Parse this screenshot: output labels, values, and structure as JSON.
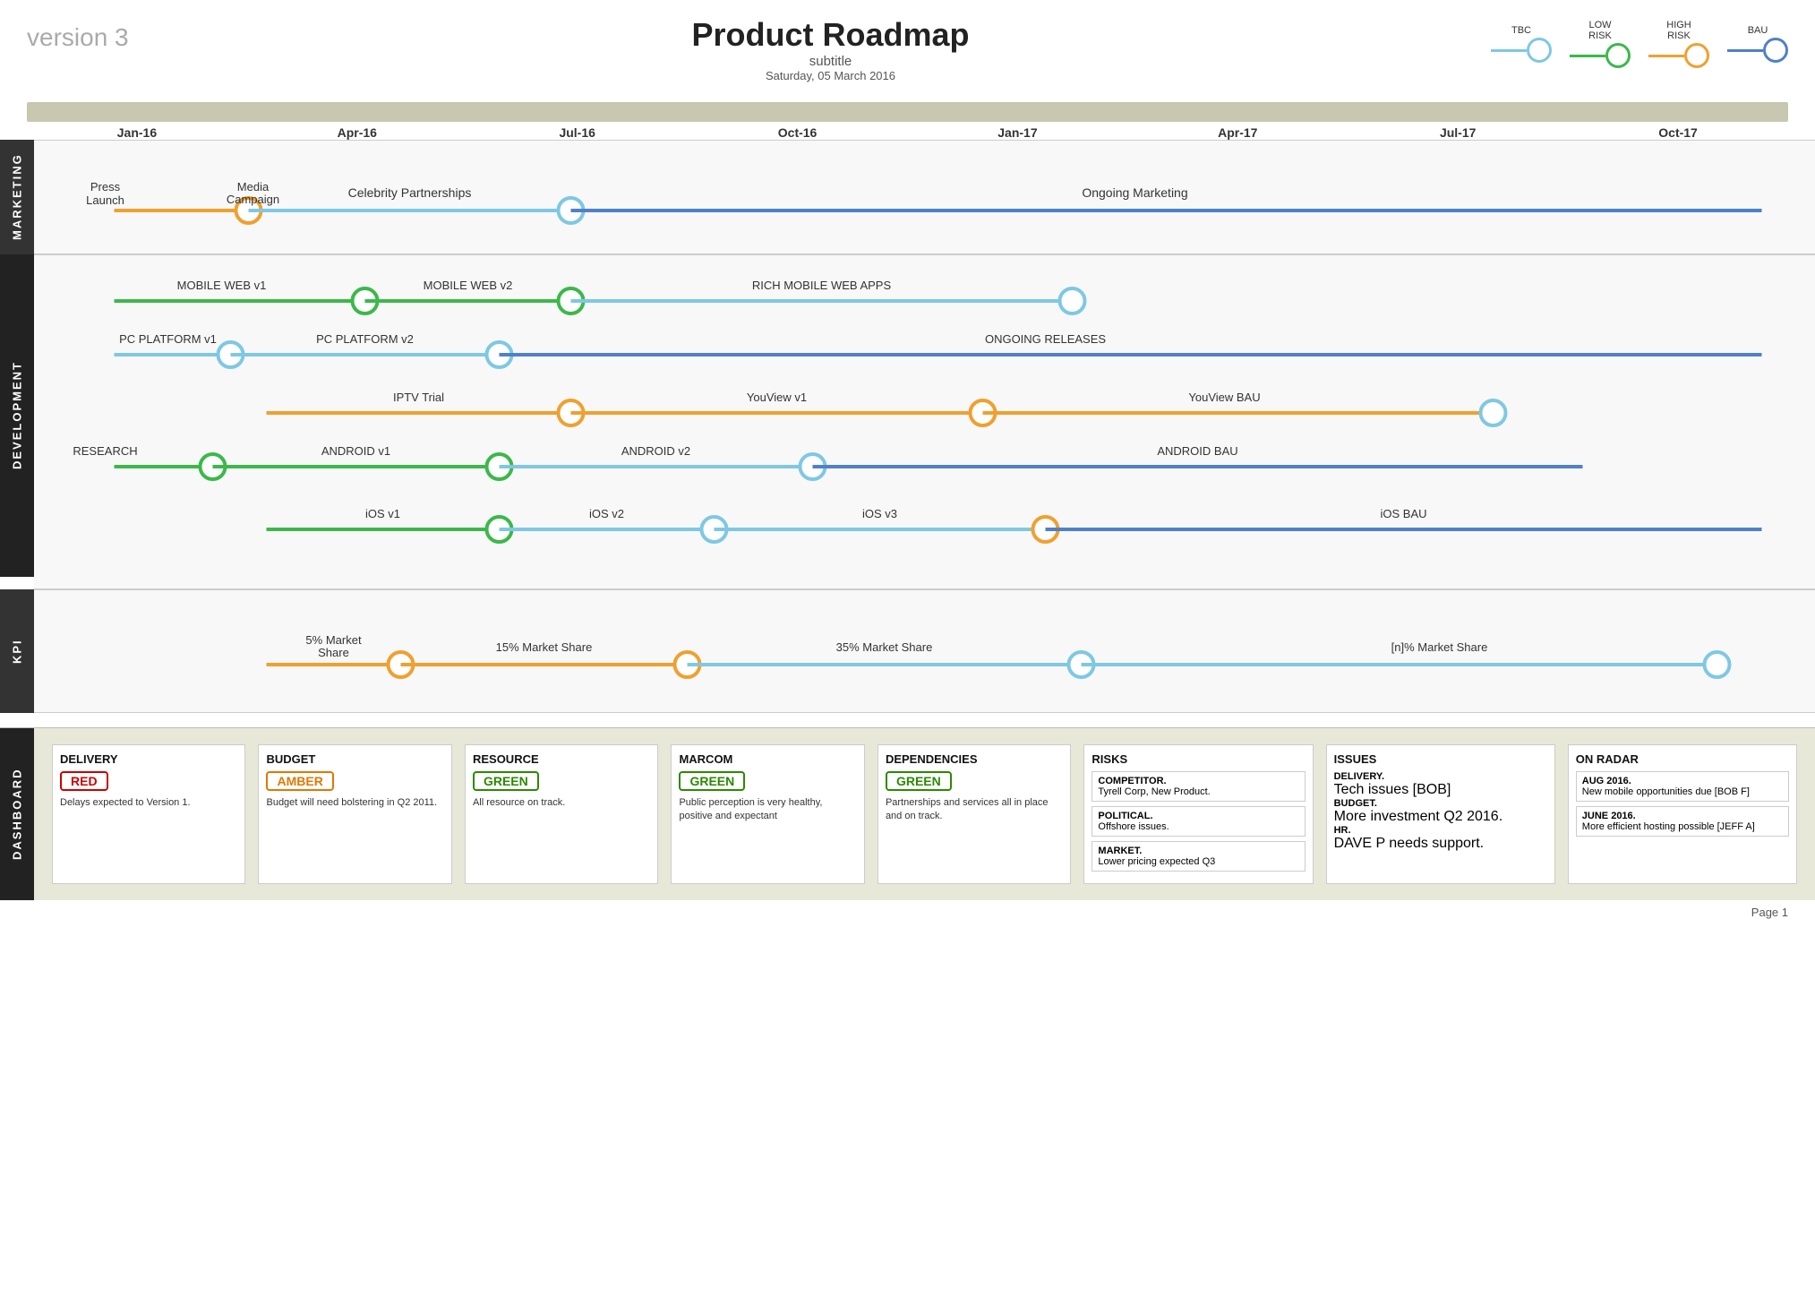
{
  "header": {
    "version": "version 3",
    "title": "Product Roadmap",
    "subtitle": "subtitle",
    "date": "Saturday, 05 March 2016"
  },
  "legend": {
    "items": [
      {
        "label": "TBC",
        "color": "#7ec8e3",
        "line_color": "#7ec8e3"
      },
      {
        "label": "LOW\nRISK",
        "color": "#3cb84a",
        "line_color": "#3cb84a"
      },
      {
        "label": "HIGH\nRISK",
        "color": "#f0a030",
        "line_color": "#f0a030"
      },
      {
        "label": "BAU",
        "color": "#5080c8",
        "line_color": "#5080c8"
      }
    ]
  },
  "timeline": {
    "labels": [
      "Jan-16",
      "Apr-16",
      "Jul-16",
      "Oct-16",
      "Jan-17",
      "Apr-17",
      "Jul-17",
      "Oct-17"
    ]
  },
  "sections": {
    "marketing": {
      "label": "MARKETING"
    },
    "development": {
      "label": "DEVELOPMENT"
    },
    "kpi": {
      "label": "KPI"
    }
  },
  "dashboard": {
    "label": "DASHBOARD",
    "cards": [
      {
        "title": "DELIVERY",
        "badge": "RED",
        "badge_type": "red",
        "text": "Delays expected to Version 1."
      },
      {
        "title": "BUDGET",
        "badge": "AMBER",
        "badge_type": "amber",
        "text": "Budget will need bolstering in Q2 2011."
      },
      {
        "title": "RESOURCE",
        "badge": "GREEN",
        "badge_type": "green",
        "text": "All resource on track."
      },
      {
        "title": "MARCOM",
        "badge": "GREEN",
        "badge_type": "green",
        "text": "Public perception is very healthy, positive and expectant"
      },
      {
        "title": "DEPENDENCIES",
        "badge": "GREEN",
        "badge_type": "green",
        "text": "Partnerships and services all in place and on track."
      }
    ],
    "risks": {
      "title": "RISKS",
      "items": [
        {
          "label": "COMPETITOR.",
          "text": "Tyrell Corp, New Product."
        },
        {
          "label": "POLITICAL.",
          "text": "Offshore issues."
        },
        {
          "label": "MARKET.",
          "text": "Lower pricing expected Q3"
        }
      ]
    },
    "issues": {
      "title": "ISSUES",
      "items": [
        {
          "label": "DELIVERY.",
          "text": "Tech issues [BOB]"
        },
        {
          "label": "BUDGET.",
          "text": "More investment Q2 2016."
        },
        {
          "label": "HR.",
          "text": "DAVE P needs support."
        }
      ]
    },
    "on_radar": {
      "title": "ON RADAR",
      "items": [
        {
          "label": "AUG 2016.",
          "text": "New mobile opportunities due [BOB F]"
        },
        {
          "label": "JUNE 2016.",
          "text": "More efficient hosting possible [JEFF A]"
        }
      ]
    }
  },
  "page": {
    "number": "Page 1"
  }
}
